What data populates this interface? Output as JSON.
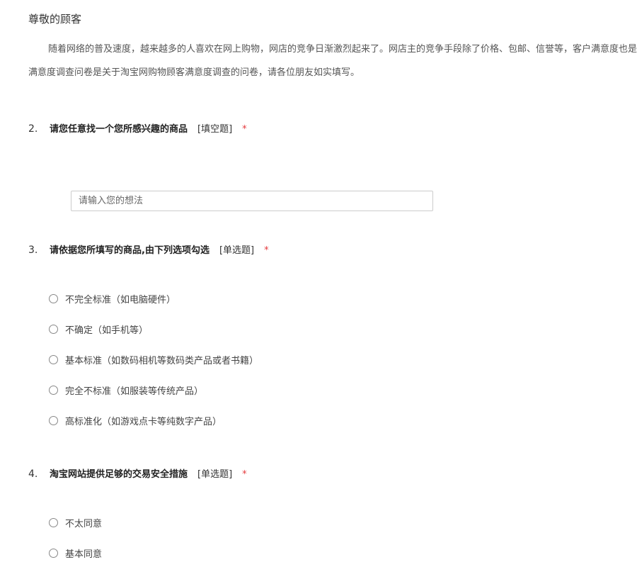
{
  "header": {
    "greeting": "尊敬的顾客"
  },
  "intro": {
    "line1": "随着网络的普及速度，越来越多的人喜欢在网上购物，网店的竞争日渐激烈起来了。网店主的竞争手段除了价格、包邮、信誉等，客户满意度也是关键。",
    "line2": "满意度调查问卷是关于淘宝网购物顾客满意度调查的问卷，请各位朋友如实填写。"
  },
  "questions": [
    {
      "number": "2.",
      "title": "请您任意找一个您所感兴趣的商品",
      "type": "[填空题]",
      "required": "*",
      "input_placeholder": "请输入您的想法",
      "input_value": ""
    },
    {
      "number": "3.",
      "title": "请依据您所填写的商品,由下列选项勾选",
      "type": "[单选题]",
      "required": "*",
      "options": [
        "不完全标准（如电脑硬件）",
        "不确定（如手机等）",
        "基本标准（如数码相机等数码类产品或者书籍）",
        "完全不标准（如服装等传统产品）",
        "高标准化（如游戏点卡等纯数字产品）"
      ]
    },
    {
      "number": "4.",
      "title": "淘宝网站提供足够的交易安全措施",
      "type": "[单选题]",
      "required": "*",
      "options": [
        "不太同意",
        "基本同意"
      ]
    }
  ],
  "colors": {
    "required_star": "#e4393c",
    "input_border": "#cccccc"
  },
  "icons": {
    "radio": "radio-unchecked-icon"
  }
}
